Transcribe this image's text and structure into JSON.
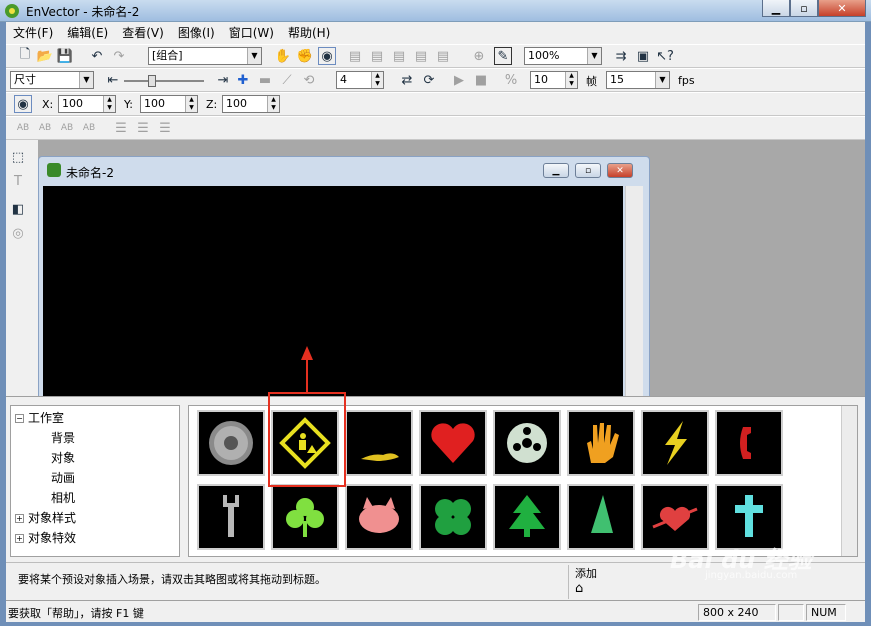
{
  "window": {
    "title": "EnVector - 未命名-2"
  },
  "menu": {
    "items": [
      "文件(F)",
      "编辑(E)",
      "查看(V)",
      "图像(I)",
      "窗口(W)",
      "帮助(H)"
    ]
  },
  "toolbar1": {
    "object_combo": "[组合]",
    "zoom_combo": "100%"
  },
  "toolbar2": {
    "size_combo": "尺寸",
    "value_spin": "4",
    "fps_spin": "10",
    "frame_label": "帧",
    "frame_combo": "15",
    "fps_label": "fps"
  },
  "toolbar3": {
    "x_label": "X:",
    "x_value": "100",
    "y_label": "Y:",
    "y_value": "100",
    "z_label": "Z:",
    "z_value": "100"
  },
  "toolbar4": {
    "items": [
      "AB",
      "AB",
      "AB",
      "AB"
    ]
  },
  "document": {
    "title": "未命名-2"
  },
  "tree": {
    "root": "工作室",
    "children": [
      "背景",
      "对象",
      "动画",
      "相机"
    ],
    "others": [
      "对象样式",
      "对象特效"
    ]
  },
  "gallery": {
    "items": [
      {
        "name": "gear",
        "color": "#b0b0b0"
      },
      {
        "name": "construction-sign",
        "color": "#e8e020"
      },
      {
        "name": "kangaroo",
        "color": "#e0c020"
      },
      {
        "name": "heart",
        "color": "#e02020"
      },
      {
        "name": "film-reel",
        "color": "#d0e0d0"
      },
      {
        "name": "hand",
        "color": "#f0a020"
      },
      {
        "name": "lightning",
        "color": "#e8d020"
      },
      {
        "name": "phone",
        "color": "#d02020"
      },
      {
        "name": "wrench",
        "color": "#b8b8b8"
      },
      {
        "name": "shamrock",
        "color": "#80e040"
      },
      {
        "name": "cat-face",
        "color": "#f09090"
      },
      {
        "name": "clover",
        "color": "#20a040"
      },
      {
        "name": "tree",
        "color": "#20b040"
      },
      {
        "name": "sail",
        "color": "#40c070"
      },
      {
        "name": "heart-arrow",
        "color": "#e04040"
      },
      {
        "name": "cross",
        "color": "#60e0e0"
      }
    ]
  },
  "hint": {
    "text": "要将某个预设对象插入场景，请双击其略图或将其拖动到标题。",
    "add_label": "添加"
  },
  "status": {
    "help": "要获取「帮助」，请按 F1 键",
    "size": "800 x 240",
    "num": "NUM"
  },
  "watermark": {
    "text": "Bai du 经验",
    "sub": "jingyan.baidu.com"
  }
}
